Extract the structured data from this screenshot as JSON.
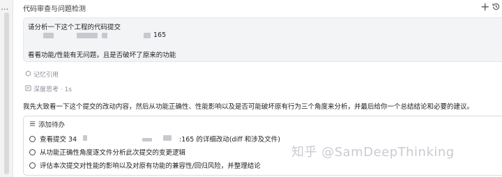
{
  "header": {
    "title": "代码审查与问题检测",
    "left_dots": "...",
    "new_chat_icon": "plus-icon",
    "history_icon": "history-icon"
  },
  "user_message": {
    "line1": "请分析一下这个工程的代码提交",
    "line2_suffix": "165",
    "line3": "看看功能/性能有无问题，且是否破坏了原来的功能"
  },
  "memory": {
    "label": "记忆引用"
  },
  "thinking": {
    "label": "深度思考 · 1s"
  },
  "answer": {
    "text": "我先大致看一下这个提交的改动内容，然后从功能正确性、性能影响以及是否可能破坏原有行为三个角度来分析，并最后给你一个总结结论和必要的建议。"
  },
  "todo": {
    "title": "添加待办",
    "items": [
      {
        "prefix": "查看提交 34",
        "suffix": ":165 的详细改动(diff 和涉及文件)"
      },
      {
        "text": "从功能正确性角度逐文件分析此次提交的变更逻辑"
      },
      {
        "text": "评估本次提交对性能的影响以及对原有功能的兼容性/回归风险，并整理结论"
      }
    ]
  },
  "watermark": "知乎 @SamDeepThinking"
}
